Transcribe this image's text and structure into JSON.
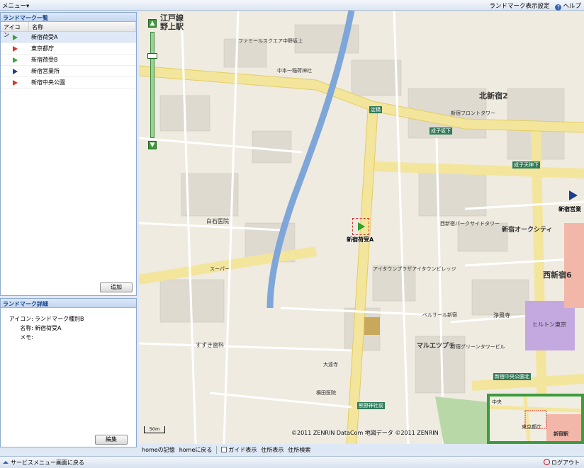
{
  "menubar": {
    "menu_label": "メニュー▾",
    "display_settings_label": "ランドマーク表示設定",
    "help_label": "ヘルプ"
  },
  "landmark_list": {
    "title": "ランドマーク一覧",
    "columns": [
      "アイコン",
      "名称"
    ],
    "rows": [
      {
        "name": "新宿荷受A",
        "flag_color": "#3aa23a",
        "selected": true
      },
      {
        "name": "東京都庁",
        "flag_color": "#d23a2a",
        "selected": false
      },
      {
        "name": "新宿荷受B",
        "flag_color": "#3aa23a",
        "selected": false
      },
      {
        "name": "新宿営業所",
        "flag_color": "#1f3e8c",
        "selected": false
      },
      {
        "name": "新宿中央公園",
        "flag_color": "#d23a2a",
        "selected": false
      }
    ],
    "add_button": "追加"
  },
  "landmark_detail": {
    "title": "ランドマーク詳細",
    "icon_label": "アイコン:",
    "icon_value": "ランドマーク種別B",
    "name_label": "名称:",
    "name_value": "新宿荷受A",
    "memo_label": "メモ:",
    "memo_value": "",
    "edit_button": "編集"
  },
  "map_toolbar": {
    "home_memory": "homeの記憶",
    "home_return": "homeに戻る",
    "guide_display": "ガイド表示",
    "address_display": "住所表示",
    "address_search": "住所検索"
  },
  "map": {
    "copyright": "©2011 ZENRIN DataCom 地図データ ©2011 ZENRIN",
    "scale_label": "50m",
    "station_label": "野上駅",
    "line_label": "江戸線",
    "district_kitashinjuku": "北新宿2",
    "district_nishishinjuku": "西新宿6",
    "landmark_marker_a": "新宿荷受A",
    "landmark_marker_office": "新宿営業",
    "labels": [
      "中本一稲荷神社",
      "淀橋",
      "成子坂下",
      "成子天神下",
      "新宿オークシティ",
      "白石医院",
      "新宿フロントタワー",
      "西新宿パークサイドタワー",
      "ヒルトン東京",
      "マルエツプチ",
      "浄風寺",
      "熊野神社前",
      "新宿中央公園北",
      "すずき歯科",
      "横田医院",
      "大遠寺",
      "アイタウンプラザアイタウンビレッジ",
      "ファミールスクエア中野坂上",
      "スーパー",
      "ベルサール新宿",
      "新宿グリーンタワービル"
    ],
    "overview_labels": [
      "中央",
      "東京都庁",
      "新宿駅"
    ]
  },
  "statusbar": {
    "back_link": "サービスメニュー画面に戻る",
    "logout": "ログアウト"
  }
}
